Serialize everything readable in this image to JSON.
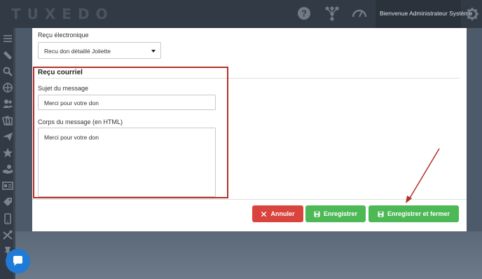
{
  "header": {
    "logo": "TUXEDO",
    "welcome": "Bienvenue Administrateur Système",
    "icons": [
      "help-icon",
      "network-icon",
      "speedometer-icon",
      "gear-icon"
    ]
  },
  "sidebar": {
    "icons": [
      "menu-icon",
      "ticket-icon",
      "search-icon",
      "target-icon",
      "users-icon",
      "documents-icon",
      "send-icon",
      "star-icon",
      "donation-icon",
      "id-card-icon",
      "tag-icon",
      "mobile-icon",
      "tools-icon",
      "pin-icon"
    ]
  },
  "form": {
    "receipt_label": "Reçu électronique",
    "receipt_select_value": "Recu don détaillé Joliette",
    "email_section_title": "Reçu courriel",
    "subject_label": "Sujet du message",
    "subject_value": "Merci pour votre don",
    "body_label": "Corps du message (en HTML)",
    "body_value": "Merci pour votre don"
  },
  "actions": {
    "cancel_label": "Annuler",
    "save_label": "Enregistrer",
    "save_close_label": "Enregistrer et fermer"
  },
  "colors": {
    "header_bg": "#323b45",
    "danger": "#d9443f",
    "success": "#4db856",
    "annotation": "#b4302a",
    "chat": "#1f7ad8"
  }
}
